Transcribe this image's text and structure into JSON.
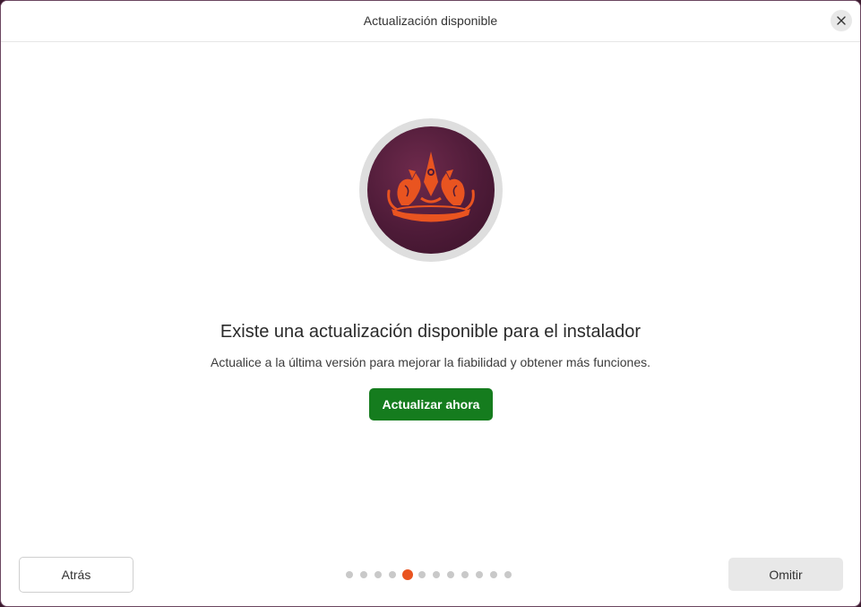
{
  "window": {
    "title": "Actualización disponible",
    "close_icon": "close-icon"
  },
  "hero": {
    "logo_icon": "crown-logo-icon",
    "headline": "Existe una actualización disponible para el instalador",
    "description": "Actualice a la última versión para mejorar la fiabilidad y obtener más funciones.",
    "update_button_label": "Actualizar ahora"
  },
  "footer": {
    "back_label": "Atrás",
    "skip_label": "Omitir",
    "progress": {
      "total_steps": 12,
      "current_step": 5
    }
  },
  "colors": {
    "accent": "#E95420",
    "primary_button": "#157C1E",
    "logo_background": "#4E1B38",
    "dot_inactive": "#C9C9C9"
  }
}
